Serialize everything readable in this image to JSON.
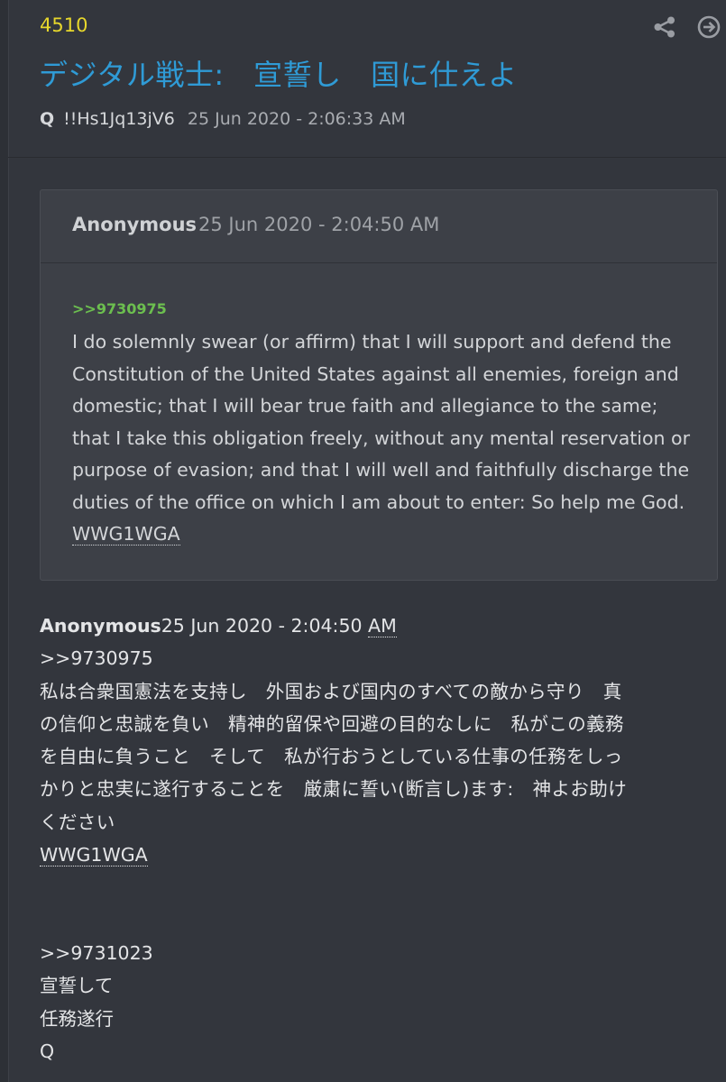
{
  "post": {
    "number": "4510",
    "title": "デジタル戦士:　宣誓し　国に仕えよ",
    "author": "Q",
    "tripcode": "!!Hs1Jq13jV6",
    "timestamp": "25 Jun 2020 - 2:06:33 AM"
  },
  "icons": {
    "share": "share-icon",
    "next": "arrow-right-circle-icon",
    "color": "#9a9da3"
  },
  "quoted_post": {
    "author": "Anonymous",
    "timestamp": "25 Jun 2020 - 2:04:50 AM",
    "reply_link": ">>9730975",
    "lines": [
      "I do solemnly swear (or affirm) that I will support and defend the",
      "Constitution of the United States against all enemies, foreign and",
      "domestic; that I will bear true faith and allegiance to the same;",
      "that I take this obligation freely, without any mental reservation or",
      "purpose of evasion; and that I will well and faithfully discharge the",
      "duties of the office on which I am about to enter: So help me God."
    ],
    "tag": "WWG1WGA"
  },
  "reply": {
    "author": "Anonymous",
    "timestamp_main": "25 Jun 2020 - 2:04:50 ",
    "timestamp_ampm": "AM",
    "reply_link": ">>9730975",
    "jp_lines": [
      "私は合衆国憲法を支持し　外国および国内のすべての敵から守り　真",
      "の信仰と忠誠を負い　精神的留保や回避の目的なしに　私がこの義務",
      "を自由に負うこと　そして　私が行おうとしている仕事の任務をしっ",
      "かりと忠実に遂行することを　厳粛に誓い(断言し)ます:　神よお助け",
      "ください"
    ],
    "tag": "WWG1WGA",
    "q_reply_link": ">>9731023",
    "q_lines": [
      "宣誓して",
      "任務遂行",
      "Q"
    ]
  },
  "colors": {
    "background": "#33363d",
    "post_number": "#e7d72c",
    "title": "#2f9bd6",
    "greentext": "#6cbf4f"
  }
}
